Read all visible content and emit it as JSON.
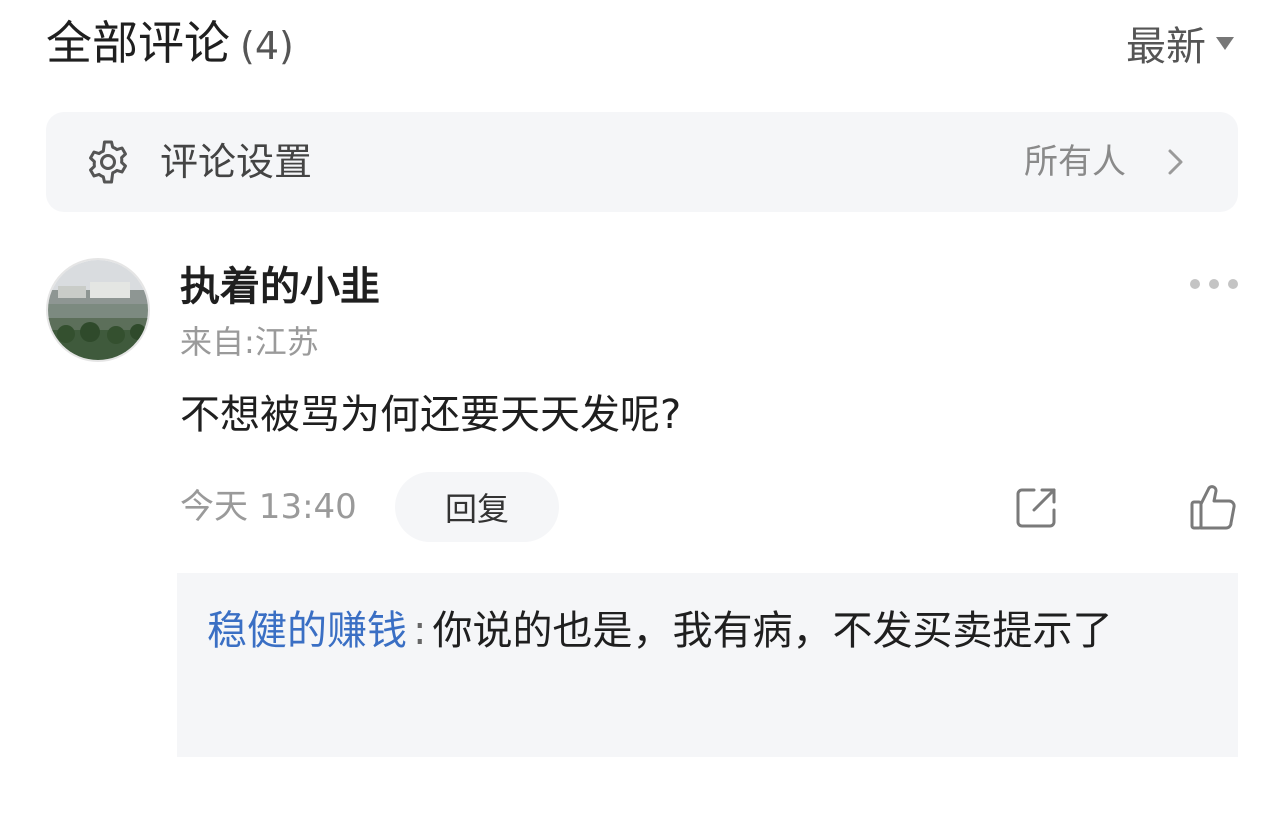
{
  "header": {
    "title": "全部评论",
    "count": "(4)",
    "sort_label": "最新",
    "sort_icon": "caret-down-icon"
  },
  "settings": {
    "label": "评论设置",
    "value": "所有人",
    "icon": "gear-icon",
    "chevron": "chevron-right-icon"
  },
  "comment": {
    "username": "执着的小韭",
    "location": "来自:江苏",
    "text": "不想被骂为何还要天天发呢?",
    "time": "今天 13:40",
    "reply_label": "回复",
    "icons": {
      "more": "more-dots-icon",
      "share": "share-icon",
      "like": "thumbs-up-icon"
    },
    "reply": {
      "author": "稳健的赚钱",
      "separator": ":",
      "text": "你说的也是，我有病，不发买卖提示了"
    }
  },
  "colors": {
    "link_blue": "#3a6fc4",
    "panel_bg": "#f5f6f8",
    "muted_text": "#9a9a9a"
  }
}
